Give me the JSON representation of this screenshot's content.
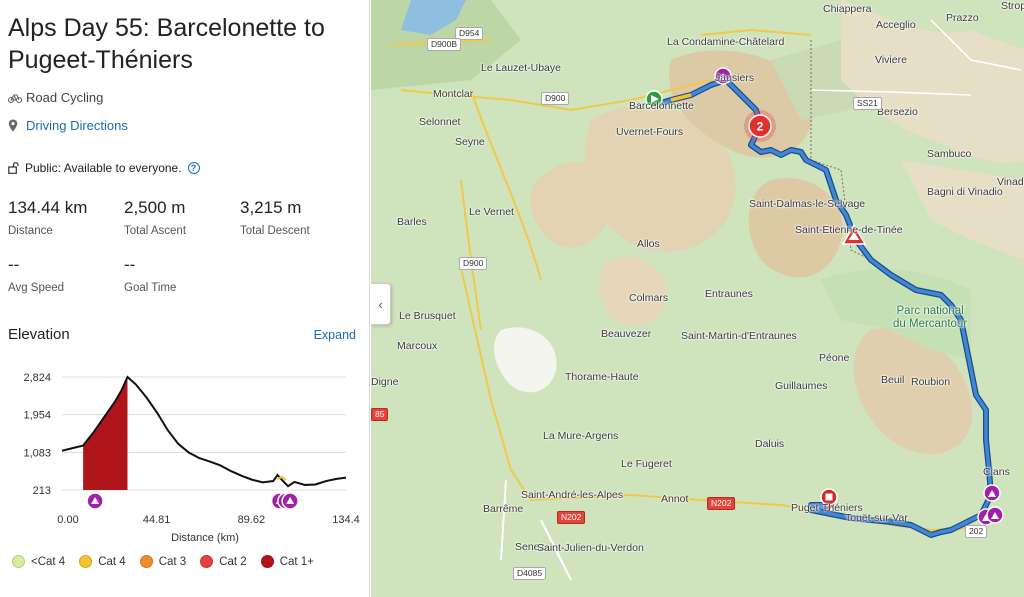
{
  "route": {
    "title": "Alps Day 55: Barcelonette to Pugeet-Théniers",
    "activity": "Road Cycling",
    "directions": "Driving Directions",
    "public": "Public: Available to everyone.",
    "help": "?"
  },
  "stats": {
    "distance": {
      "value": "134.44 km",
      "label": "Distance"
    },
    "ascent": {
      "value": "2,500 m",
      "label": "Total Ascent"
    },
    "descent": {
      "value": "3,215 m",
      "label": "Total Descent"
    },
    "speed": {
      "value": "--",
      "label": "Avg Speed"
    },
    "goal": {
      "value": "--",
      "label": "Goal Time"
    }
  },
  "elevation": {
    "title": "Elevation",
    "expand": "Expand"
  },
  "chart_data": {
    "type": "area",
    "xlabel": "Distance (km)",
    "ylabel": "",
    "x_ticks": [
      "0.00",
      "44.81",
      "89.62",
      "134.4"
    ],
    "y_ticks": [
      "2,824",
      "1,954",
      "1,083",
      "213"
    ],
    "xlim": [
      0,
      134.44
    ],
    "ylim": [
      213,
      2824
    ],
    "profile": [
      [
        0,
        1120
      ],
      [
        5,
        1180
      ],
      [
        10,
        1240
      ],
      [
        15,
        1550
      ],
      [
        20,
        1900
      ],
      [
        25,
        2250
      ],
      [
        28,
        2500
      ],
      [
        31,
        2824
      ],
      [
        35,
        2650
      ],
      [
        40,
        2350
      ],
      [
        45,
        2000
      ],
      [
        50,
        1600
      ],
      [
        55,
        1280
      ],
      [
        60,
        1080
      ],
      [
        65,
        950
      ],
      [
        70,
        870
      ],
      [
        75,
        780
      ],
      [
        80,
        650
      ],
      [
        85,
        540
      ],
      [
        90,
        450
      ],
      [
        95,
        390
      ],
      [
        100,
        420
      ],
      [
        102,
        560
      ],
      [
        104,
        450
      ],
      [
        107,
        300
      ],
      [
        110,
        400
      ],
      [
        115,
        330
      ],
      [
        120,
        340
      ],
      [
        125,
        420
      ],
      [
        130,
        470
      ],
      [
        134.44,
        500
      ]
    ],
    "climb_shading": {
      "start_km": 10,
      "end_km": 31,
      "category": "Cat 1+"
    },
    "climb_markers_km": [
      10,
      103,
      106,
      108
    ],
    "legend": [
      {
        "label": "<Cat 4",
        "color": "#d4ef9c"
      },
      {
        "label": "Cat 4",
        "color": "#f3c22f"
      },
      {
        "label": "Cat 3",
        "color": "#f28b2c"
      },
      {
        "label": "Cat 2",
        "color": "#e3433a"
      },
      {
        "label": "Cat 1+",
        "color": "#b0151b"
      }
    ],
    "colors": {
      "line": "#111111",
      "shade": "#b0151b",
      "marker": "#a31faa"
    }
  },
  "map": {
    "collapse_icon": "‹",
    "labels": [
      "Chiappera",
      "Acceglio",
      "Prazzo",
      "Stroppo",
      "La Condamine-Châtelard",
      "Viviere",
      "Le Lauzet-Ubaye",
      "Jausiers",
      "Bersezio",
      "Montclar",
      "Barcelonnette",
      "Selonnet",
      "Uvernet-Fours",
      "Sambuco",
      "Seyne",
      "Bagni di Vinadio",
      "Vinadi",
      "Saint-Dalmas-le-Selvage",
      "Barles",
      "Le Vernet",
      "Saint-Etienne-de-Tinée",
      "Allos",
      "Colmars",
      "Entraunes",
      "Le Brusquet",
      "Beauvezer",
      "Saint-Martin-d'Entraunes",
      "Marcoux",
      "Péone",
      "Thorame-Haute",
      "Beuil",
      "Roubion",
      "Guillaumes",
      "Digne",
      "La Mure-Argens",
      "Daluis",
      "Le Fugeret",
      "Clans",
      "Saint-André-les-Alpes",
      "Annot",
      "Barrême",
      "Puget-Théniers",
      "Touët-sur-Var",
      "Senez",
      "Saint-Julien-du-Verdon"
    ],
    "park_label": "Parc national du Mercantour",
    "roads": [
      "D954",
      "D900B",
      "D900",
      "SS21",
      "D900",
      "N202",
      "N202",
      "D4085",
      "202",
      "85"
    ],
    "waypoint_number": "2"
  }
}
